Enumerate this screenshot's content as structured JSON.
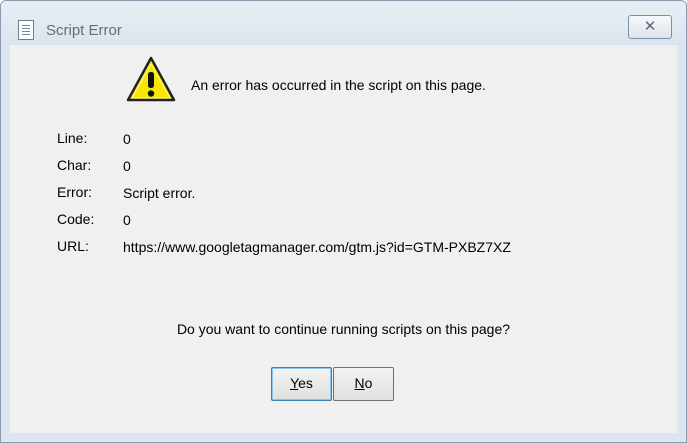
{
  "window": {
    "title": "Script Error",
    "close_symbol": "✕"
  },
  "dialog": {
    "message": "An error has occurred in the script on this page.",
    "fields": [
      {
        "label": "Line:",
        "value": "0"
      },
      {
        "label": "Char:",
        "value": "0"
      },
      {
        "label": "Error:",
        "value": "Script error."
      },
      {
        "label": "Code:",
        "value": "0"
      },
      {
        "label": "URL:",
        "value": "https://www.googletagmanager.com/gtm.js?id=GTM-PXBZ7XZ"
      }
    ],
    "question": "Do you want to continue running scripts on this page?",
    "yes_button": {
      "mnemonic": "Y",
      "rest": "es"
    },
    "no_button": {
      "mnemonic": "N",
      "rest": "o"
    }
  },
  "icons": {
    "app": "document-icon",
    "warning": "warning-icon",
    "close": "close-icon"
  },
  "colors": {
    "warning_fill": "#f7e600",
    "frame": "#dde6f0",
    "client": "#f0f0f0"
  }
}
